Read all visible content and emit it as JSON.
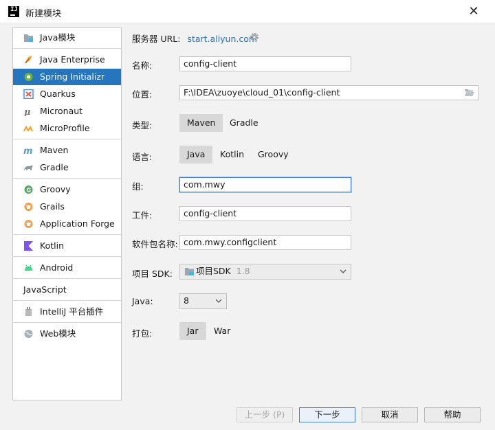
{
  "window": {
    "title": "新建模块"
  },
  "sidebar": {
    "items": [
      {
        "label": "Java模块",
        "icon": "folder-module-icon"
      },
      {
        "label": "Java Enterprise",
        "icon": "java-enterprise-icon"
      },
      {
        "label": "Spring Initializr",
        "icon": "spring-icon",
        "selected": true
      },
      {
        "label": "Quarkus",
        "icon": "quarkus-icon"
      },
      {
        "label": "Micronaut",
        "icon": "micronaut-icon"
      },
      {
        "label": "MicroProfile",
        "icon": "microprofile-icon"
      },
      {
        "label": "Maven",
        "icon": "maven-icon"
      },
      {
        "label": "Gradle",
        "icon": "gradle-icon"
      },
      {
        "label": "Groovy",
        "icon": "groovy-icon"
      },
      {
        "label": "Grails",
        "icon": "grails-icon"
      },
      {
        "label": "Application Forge",
        "icon": "application-forge-icon"
      },
      {
        "label": "Kotlin",
        "icon": "kotlin-icon"
      },
      {
        "label": "Android",
        "icon": "android-icon"
      },
      {
        "label": "JavaScript",
        "icon": ""
      },
      {
        "label": "IntelliJ 平台插件",
        "icon": "intellij-plugin-icon"
      },
      {
        "label": "Web模块",
        "icon": "web-globe-icon"
      }
    ]
  },
  "form": {
    "server_url_label": "服务器 URL:",
    "server_url": "start.aliyun.com",
    "name_label": "名称:",
    "name_value": "config-client",
    "location_label": "位置:",
    "location_value": "F:\\IDEA\\zuoye\\cloud_01\\config-client",
    "type_label": "类型:",
    "type_options": [
      "Maven",
      "Gradle"
    ],
    "language_label": "语言:",
    "language_options": [
      "Java",
      "Kotlin",
      "Groovy"
    ],
    "group_label": "组:",
    "group_value": "com.mwy",
    "artifact_label": "工件:",
    "artifact_value": "config-client",
    "package_label": "软件包名称:",
    "package_value": "com.mwy.configclient",
    "sdk_label": "项目 SDK:",
    "sdk_value": "项目SDK",
    "sdk_version": "1.8",
    "java_label": "Java:",
    "java_value": "8",
    "packaging_label": "打包:",
    "packaging_options": [
      "Jar",
      "War"
    ]
  },
  "buttons": {
    "previous": "上一步 (P)",
    "next": "下一步",
    "cancel": "取消",
    "help": "帮助"
  },
  "colors": {
    "selection": "#2675bf",
    "link": "#2c6fb8",
    "focus": "#3e7fcc"
  }
}
